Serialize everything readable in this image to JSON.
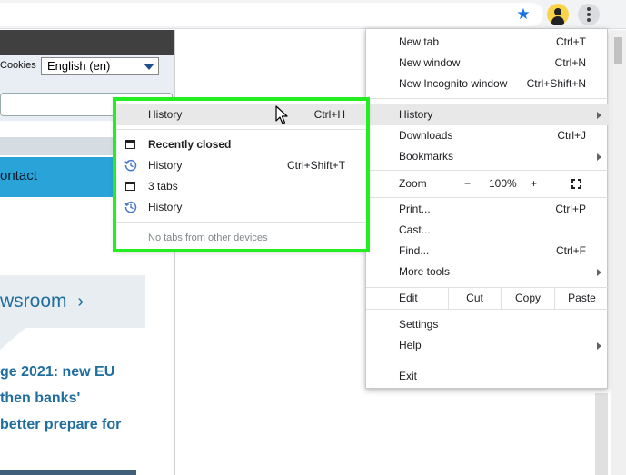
{
  "page": {
    "cookies_label": "Cookies",
    "language_selected": "English (en)",
    "contact_nav": "ontact",
    "newsroom_heading": "wsroom",
    "headline_lines": [
      "ge 2021: new EU",
      "then banks'",
      "better prepare for"
    ]
  },
  "menu": {
    "new_tab": {
      "label": "New tab",
      "shortcut": "Ctrl+T"
    },
    "new_window": {
      "label": "New window",
      "shortcut": "Ctrl+N"
    },
    "new_incognito": {
      "label": "New Incognito window",
      "shortcut": "Ctrl+Shift+N"
    },
    "history": {
      "label": "History"
    },
    "downloads": {
      "label": "Downloads",
      "shortcut": "Ctrl+J"
    },
    "bookmarks": {
      "label": "Bookmarks"
    },
    "zoom": {
      "label": "Zoom",
      "minus": "−",
      "level": "100%",
      "plus": "+"
    },
    "print": {
      "label": "Print...",
      "shortcut": "Ctrl+P"
    },
    "cast": {
      "label": "Cast..."
    },
    "find": {
      "label": "Find...",
      "shortcut": "Ctrl+F"
    },
    "more_tools": {
      "label": "More tools"
    },
    "edit": {
      "label": "Edit",
      "cut": "Cut",
      "copy": "Copy",
      "paste": "Paste"
    },
    "settings": {
      "label": "Settings"
    },
    "help": {
      "label": "Help"
    },
    "exit": {
      "label": "Exit"
    }
  },
  "history_submenu": {
    "history": {
      "label": "History",
      "shortcut": "Ctrl+H"
    },
    "recently_closed": "Recently closed",
    "item1": {
      "label": "History",
      "shortcut": "Ctrl+Shift+T"
    },
    "item2": {
      "label": "3 tabs"
    },
    "item3": {
      "label": "History"
    },
    "no_tabs": "No tabs from other devices"
  },
  "colors": {
    "highlight_frame": "#22ee22",
    "accent": "#1a73e8",
    "nav_blue": "#2aa3d8",
    "link_blue": "#1f6e9e"
  },
  "icons": [
    "star-icon",
    "profile-icon",
    "kebab-menu-icon",
    "tab-icon",
    "history-clock-icon",
    "fullscreen-icon",
    "submenu-arrow-icon",
    "mouse-cursor-icon"
  ]
}
